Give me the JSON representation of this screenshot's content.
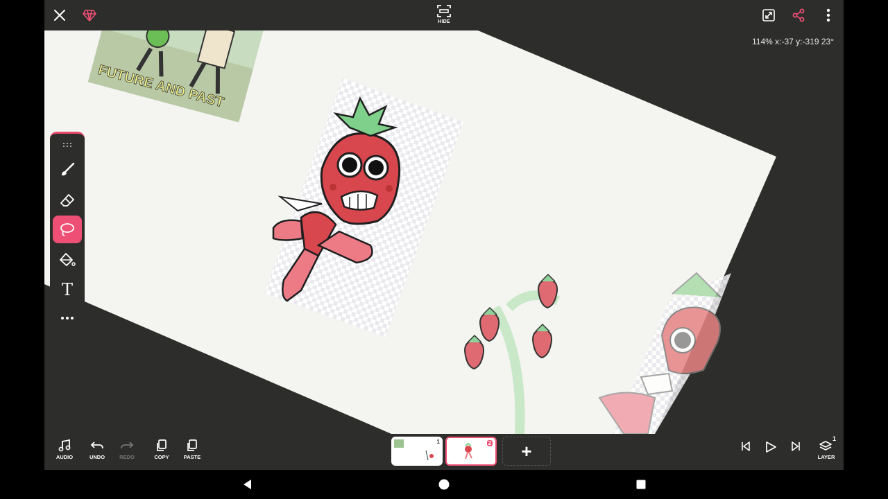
{
  "topbar": {
    "hide_label": "HIDE",
    "zoom_readout": "114% x:-37 y:-319 23°",
    "icons": [
      "close-icon",
      "gem-icon",
      "hide-icon",
      "fit-screen-icon",
      "share-icon",
      "more-vert-icon"
    ]
  },
  "canvas": {
    "sticker_text": "FUTURE AND PAST"
  },
  "toolbar": {
    "tools": [
      "drag-handle-icon",
      "brush-icon",
      "eraser-icon",
      "lasso-icon",
      "fill-bucket-icon",
      "text-tool-icon",
      "more-horiz-icon"
    ],
    "active_tool": "lasso-icon",
    "text_tool_glyph": "T"
  },
  "bottombar": {
    "audio_label": "AUDIO",
    "undo_label": "UNDO",
    "redo_label": "REDO",
    "copy_label": "COPY",
    "paste_label": "PASTE",
    "frames": [
      {
        "number": "1",
        "active": false
      },
      {
        "number": "2",
        "active": true
      }
    ],
    "add_frame_glyph": "+",
    "layer_label": "LAYER",
    "layer_count": "1"
  },
  "colors": {
    "accent": "#ee4f74",
    "bar_bg": "#2d2d2b",
    "paper": "#f4f4f1",
    "strawberry_red": "#d9474e",
    "leaf_green": "#8fd39a"
  }
}
